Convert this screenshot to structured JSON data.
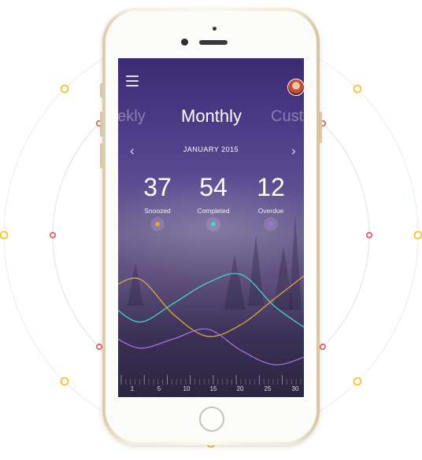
{
  "app": {
    "tabs": [
      "eekly",
      "Monthly",
      "Custo"
    ],
    "active_tab": "Monthly",
    "month": "JANUARY 2015",
    "prev_icon": "chevron-left-icon",
    "next_icon": "chevron-right-icon",
    "menu_icon": "menu-icon",
    "stats": [
      {
        "value": "37",
        "label": "Snoozed",
        "color": "#e6a53c"
      },
      {
        "value": "54",
        "label": "Completed",
        "color": "#4ad4c8"
      },
      {
        "value": "12",
        "label": "Overdue",
        "color": "#a86fe0"
      }
    ],
    "x_ticks": [
      "1",
      "5",
      "10",
      "15",
      "20",
      "25",
      "30"
    ]
  },
  "colors": {
    "deco_yellow": "#f2c230",
    "deco_red": "#e8505b",
    "deco_ring": "#e8e8e8"
  },
  "chart_data": {
    "type": "line",
    "x": [
      1,
      5,
      10,
      15,
      20,
      25,
      30
    ],
    "series": [
      {
        "color": "#4ad4c8",
        "values": [
          0.55,
          0.42,
          0.58,
          0.75,
          0.82,
          0.55,
          0.35
        ]
      },
      {
        "color": "#e6a53c",
        "values": [
          0.72,
          0.78,
          0.48,
          0.3,
          0.4,
          0.62,
          0.84
        ]
      },
      {
        "color": "#a86fe0",
        "values": [
          0.3,
          0.2,
          0.28,
          0.36,
          0.18,
          0.06,
          0.14
        ]
      }
    ]
  }
}
